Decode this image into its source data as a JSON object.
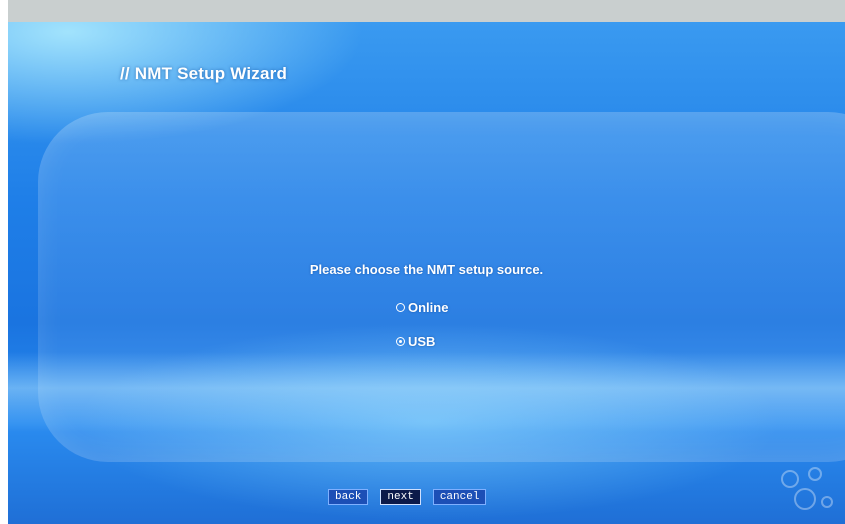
{
  "wizard": {
    "title": "// NMT Setup Wizard",
    "prompt": "Please choose the NMT setup source.",
    "options": [
      {
        "label": "Online",
        "selected": false
      },
      {
        "label": "USB",
        "selected": true
      }
    ],
    "buttons": {
      "back": "back",
      "next": "next",
      "cancel": "cancel"
    },
    "focused_button": "next"
  },
  "colors": {
    "background_blue": "#1f7fe8",
    "button_blue": "#1c4fb6",
    "button_focused": "#0c1a4a",
    "text": "#ffffff"
  }
}
